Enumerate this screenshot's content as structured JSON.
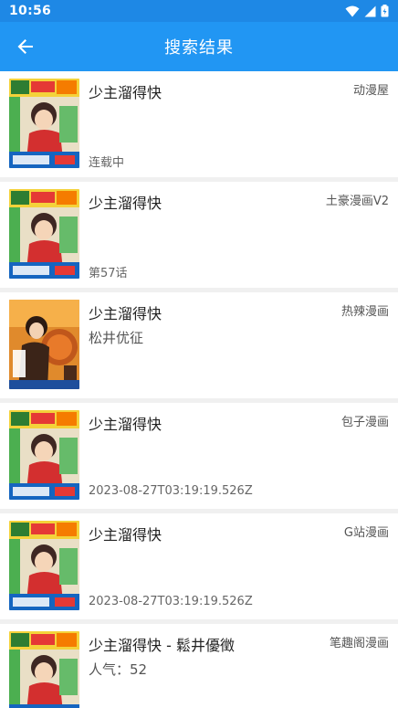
{
  "status": {
    "time": "10:56"
  },
  "header": {
    "title": "搜索结果"
  },
  "results": [
    {
      "title": "少主溜得快",
      "source": "动漫屋",
      "subtitle": "",
      "meta": "连载中",
      "cover": "jump"
    },
    {
      "title": "少主溜得快",
      "source": "土豪漫画V2",
      "subtitle": "",
      "meta": "第57话",
      "cover": "jump"
    },
    {
      "title": "少主溜得快",
      "source": "热辣漫画",
      "subtitle": "松井优征",
      "meta": "",
      "cover": "orange"
    },
    {
      "title": "少主溜得快",
      "source": "包子漫画",
      "subtitle": "",
      "meta": "2023-08-27T03:19:19.526Z",
      "cover": "jump"
    },
    {
      "title": "少主溜得快",
      "source": "G站漫画",
      "subtitle": "",
      "meta": "2023-08-27T03:19:19.526Z",
      "cover": "jump"
    },
    {
      "title": "少主溜得快 - 鬆井優徵",
      "source": "笔趣阁漫画",
      "subtitle": "人气：52",
      "meta": "",
      "cover": "jump"
    }
  ]
}
